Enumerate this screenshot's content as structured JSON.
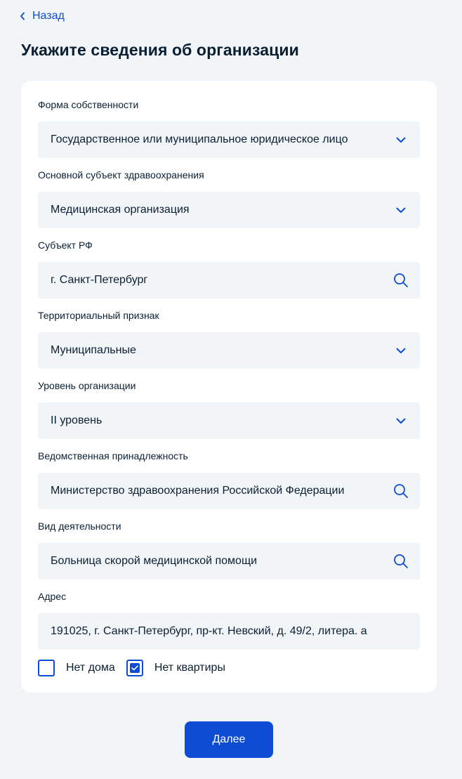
{
  "colors": {
    "accent": "#0D4CD3",
    "text": "#0B1F33",
    "page_background": "#F2F5F8",
    "field_background": "#F2F5F8",
    "card_background": "#FFFFFF"
  },
  "nav": {
    "back_label": "Назад",
    "back_icon": "chevron-left-icon"
  },
  "page": {
    "title": "Укажите сведения об организации"
  },
  "form": {
    "fields": [
      {
        "label": "Форма собственности",
        "value": "Государственное или муниципальное юридическое лицо",
        "kind": "select",
        "icon": "chevron-down-icon"
      },
      {
        "label": "Основной субъект здравоохранения",
        "value": "Медицинская организация",
        "kind": "select",
        "icon": "chevron-down-icon"
      },
      {
        "label": "Субъект РФ",
        "value": "г. Санкт-Петербург",
        "kind": "search",
        "icon": "search-icon"
      },
      {
        "label": "Территориальный признак",
        "value": "Муниципальные",
        "kind": "select",
        "icon": "chevron-down-icon"
      },
      {
        "label": "Уровень организации",
        "value": "II уровень",
        "kind": "select",
        "icon": "chevron-down-icon"
      },
      {
        "label": "Ведомственная принадлежность",
        "value": "Министерство здравоохранения Российской Федерации",
        "kind": "search",
        "icon": "search-icon"
      },
      {
        "label": "Вид деятельности",
        "value": "Больница скорой медицинской помощи",
        "kind": "search",
        "icon": "search-icon"
      },
      {
        "label": "Адрес",
        "value": "191025, г. Санкт-Петербург, пр-кт. Невский, д. 49/2, литера. а",
        "kind": "text",
        "icon": ""
      }
    ],
    "checkboxes": [
      {
        "label": "Нет дома",
        "checked": false
      },
      {
        "label": "Нет квартиры",
        "checked": true
      }
    ]
  },
  "actions": {
    "next_label": "Далее"
  }
}
